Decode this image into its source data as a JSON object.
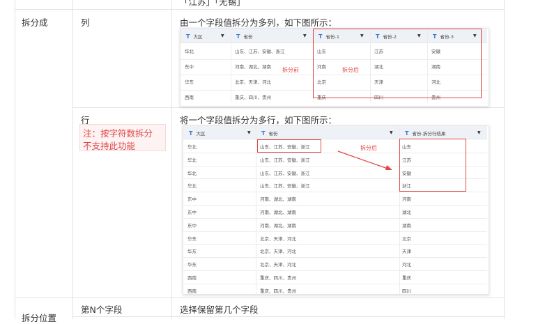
{
  "top_partial_text": "「江苏」「无锡」",
  "row1": {
    "col1": "拆分成",
    "col2": "列",
    "desc": "由一个字段值拆分为多列，如下图所示："
  },
  "row2": {
    "col2": "行",
    "note": "注：按字符数拆分不支持此功能",
    "note_line1": "注：按字符数拆分",
    "note_line2": "不支持此功能",
    "desc": "将一个字段值拆分为多行，如下图所示："
  },
  "row3": {
    "col1": "拆分位置",
    "col2": "第N个字段",
    "desc": "选择保留第几个字段"
  },
  "fig1": {
    "headers": [
      "大区",
      "省份",
      "省份-1",
      "省份-2",
      "省份-3"
    ],
    "rows": [
      [
        "华北",
        "山东、江苏、安徽、浙江",
        "山东",
        "江苏",
        "安徽"
      ],
      [
        "东中",
        "河南、湖北、湖南",
        "河南",
        "湖北",
        "湖南"
      ],
      [
        "华东",
        "北京、天津、河北",
        "北京",
        "天津",
        "河北"
      ],
      [
        "西南",
        "重庆、四川、贵州",
        "重庆",
        "四川",
        "贵州"
      ]
    ],
    "label_before": "拆分前",
    "label_after": "拆分后"
  },
  "fig2": {
    "headers": [
      "大区",
      "省份",
      "省份-拆分行结果"
    ],
    "rows": [
      [
        "华北",
        "山东、江苏、安徽、浙江",
        "山东"
      ],
      [
        "华北",
        "山东、江苏、安徽、浙江",
        "江苏"
      ],
      [
        "华北",
        "山东、江苏、安徽、浙江",
        "安徽"
      ],
      [
        "华北",
        "山东、江苏、安徽、浙江",
        "浙江"
      ],
      [
        "东中",
        "河南、湖北、湖南",
        "河南"
      ],
      [
        "东中",
        "河南、湖北、湖南",
        "湖北"
      ],
      [
        "东中",
        "河南、湖北、湖南",
        "湖南"
      ],
      [
        "华东",
        "北京、天津、河北",
        "北京"
      ],
      [
        "华东",
        "北京、天津、河北",
        "天津"
      ],
      [
        "华东",
        "北京、天津、河北",
        "河北"
      ],
      [
        "西南",
        "重庆、四川、贵州",
        "重庆"
      ],
      [
        "西南",
        "重庆、四川、贵州",
        "四川"
      ],
      [
        "西南",
        "重庆、四川、贵州",
        "贵州"
      ]
    ],
    "label_after": "拆分后"
  },
  "icons": {
    "type": "T",
    "caret": "▼"
  },
  "colors": {
    "accent_red": "#e04646",
    "type_icon": "#3a7bd5",
    "note_bg": "#fdf3f3"
  }
}
